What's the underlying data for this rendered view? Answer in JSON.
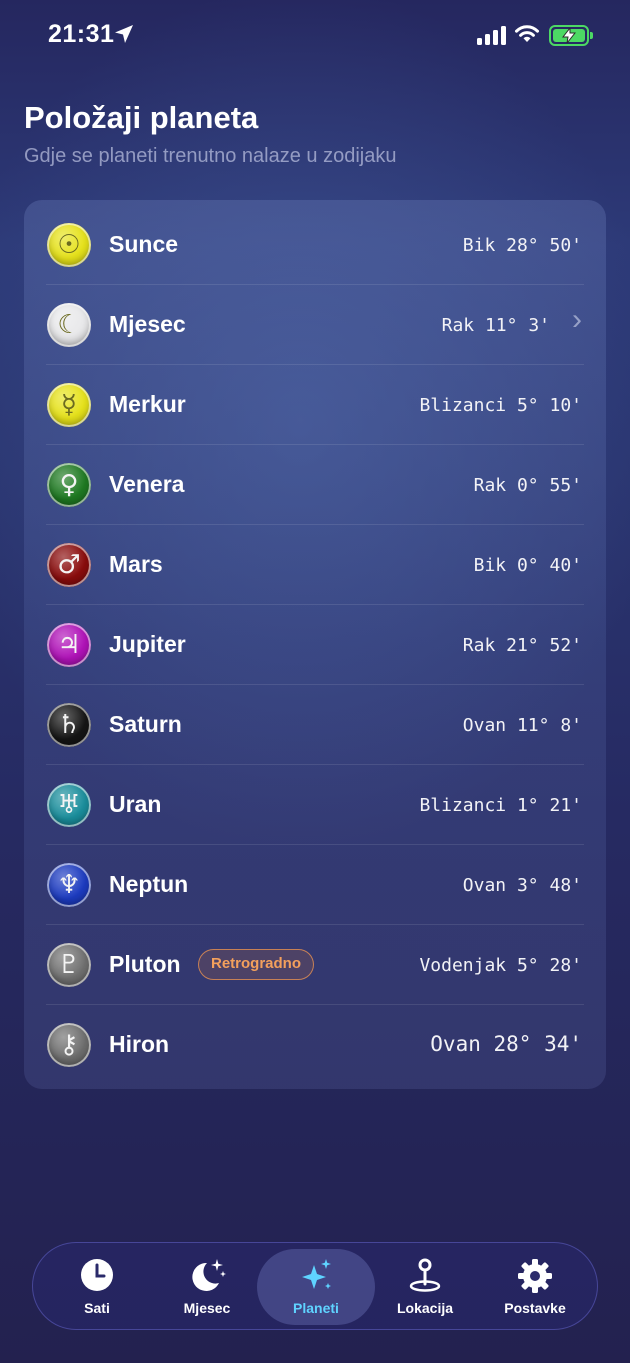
{
  "status": {
    "time": "21:31"
  },
  "header": {
    "title": "Položaji planeta",
    "subtitle": "Gdje se planeti trenutno nalaze u zodijaku"
  },
  "planets": [
    {
      "name": "Sunce",
      "position": "Bik 28° 50'",
      "icon": "sun-icon",
      "glyph": "☉",
      "color": "#e6e21a"
    },
    {
      "name": "Mjesec",
      "position": "Rak 11° 3'",
      "icon": "moon-icon",
      "glyph": "☾",
      "color": "#e8e8ea",
      "chevron": true
    },
    {
      "name": "Merkur",
      "position": "Blizanci 5° 10'",
      "icon": "mercury-icon",
      "glyph": "☿",
      "color": "#e6e21a"
    },
    {
      "name": "Venera",
      "position": "Rak 0° 55'",
      "icon": "venus-icon",
      "glyph": "♀",
      "color": "#1f7a22"
    },
    {
      "name": "Mars",
      "position": "Bik 0° 40'",
      "icon": "mars-icon",
      "glyph": "♂",
      "color": "#8a0c0c"
    },
    {
      "name": "Jupiter",
      "position": "Rak 21° 52'",
      "icon": "jupiter-icon",
      "glyph": "♃",
      "color": "#b012b8"
    },
    {
      "name": "Saturn",
      "position": "Ovan 11° 8'",
      "icon": "saturn-icon",
      "glyph": "♄",
      "color": "#151515"
    },
    {
      "name": "Uran",
      "position": "Blizanci 1° 21'",
      "icon": "uranus-icon",
      "glyph": "♅",
      "color": "#1a8e9c"
    },
    {
      "name": "Neptun",
      "position": "Ovan 3° 48'",
      "icon": "neptune-icon",
      "glyph": "♆",
      "color": "#1c3bc0"
    },
    {
      "name": "Pluton",
      "position": "Vodenjak 5° 28'",
      "icon": "pluto-icon",
      "glyph": "♇",
      "color": "#707070",
      "badge": "Retrogradno"
    },
    {
      "name": "Hiron",
      "position": "Ovan 28° 34'",
      "icon": "chiron-icon",
      "glyph": "⚷",
      "color": "#6e6e6e",
      "large": true
    }
  ],
  "tabs": [
    {
      "label": "Sati",
      "icon": "clock-icon"
    },
    {
      "label": "Mjesec",
      "icon": "moon-stars-icon"
    },
    {
      "label": "Planeti",
      "icon": "sparkles-icon",
      "active": true
    },
    {
      "label": "Lokacija",
      "icon": "location-pin-icon"
    },
    {
      "label": "Postavke",
      "icon": "gear-icon"
    }
  ]
}
